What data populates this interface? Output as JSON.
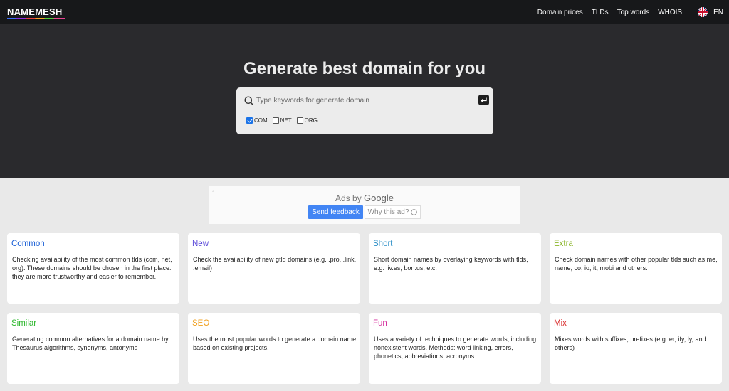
{
  "nav": {
    "logo": "NAMEMESH",
    "links": [
      "Domain prices",
      "TLDs",
      "Top words",
      "WHOIS"
    ],
    "language": "EN"
  },
  "hero": {
    "title": "Generate best domain for you",
    "search_placeholder": "Type keywords for generate domain",
    "search_value": "",
    "tlds": [
      {
        "label": "COM",
        "checked": true
      },
      {
        "label": "NET",
        "checked": false
      },
      {
        "label": "ORG",
        "checked": false
      }
    ]
  },
  "ad": {
    "ads_by": "Ads by",
    "google": "Google",
    "send_feedback": "Send feedback",
    "why_this_ad": "Why this ad?"
  },
  "cards": [
    {
      "title": "Common",
      "color": "#1a5fd6",
      "desc": "Checking availability of the most common tlds (com, net, org). These domains should be chosen in the first place: they are more trustworthy and easier to remember."
    },
    {
      "title": "New",
      "color": "#5b4ad9",
      "desc": "Check the availability of new gtld domains (e.g. .pro, .link, .email)"
    },
    {
      "title": "Short",
      "color": "#2d8fc7",
      "desc": "Short domain names by overlaying keywords with tlds, e.g. liv.es, bon.us, etc."
    },
    {
      "title": "Extra",
      "color": "#8bb52b",
      "desc": "Check domain names with other popular tlds such as me, name, co, io, it, mobi and others."
    },
    {
      "title": "Similar",
      "color": "#2eb82e",
      "desc": "Generating common alternatives for a domain name by Thesaurus algorithms, synonyms, antonyms"
    },
    {
      "title": "SEO",
      "color": "#f0a020",
      "desc": "Uses the most popular words to generate a domain name, based on existing projects."
    },
    {
      "title": "Fun",
      "color": "#d6339f",
      "desc": "Uses a variety of techniques to generate words, including nonexistent words. Methods: word linking, errors, phonetics, abbreviations, acronyms"
    },
    {
      "title": "Mix",
      "color": "#d92b2b",
      "desc": "Mixes words with suffixes, prefixes (e.g. er, ify, ly, and others)"
    }
  ]
}
